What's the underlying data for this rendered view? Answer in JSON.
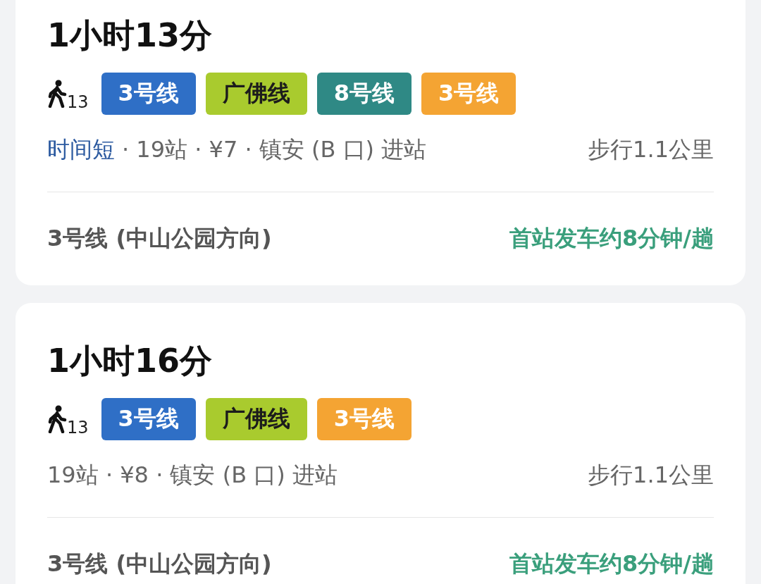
{
  "routes": [
    {
      "duration": "1小时13分",
      "walk_minutes": "13",
      "lines": [
        {
          "label": "3号线",
          "color": "#2f6fc6"
        },
        {
          "label": "广佛线",
          "color": "#a9cb2e"
        },
        {
          "label": "8号线",
          "color": "#2f8985"
        },
        {
          "label": "3号线",
          "color": "#f4a433"
        }
      ],
      "tag": "时间短",
      "summary": "· 19站 · ¥7 · 镇安 (B 口) 进站",
      "walk": "步行1.1公里",
      "first_line": "3号线 (中山公园方向)",
      "frequency": "首站发车约8分钟/趟"
    },
    {
      "duration": "1小时16分",
      "walk_minutes": "13",
      "lines": [
        {
          "label": "3号线",
          "color": "#2f6fc6"
        },
        {
          "label": "广佛线",
          "color": "#a9cb2e"
        },
        {
          "label": "3号线",
          "color": "#f4a433"
        }
      ],
      "summary": "19站 · ¥8 · 镇安 (B 口) 进站",
      "walk": "步行1.1公里",
      "first_line": "3号线 (中山公园方向)",
      "frequency": "首站发车约8分钟/趟"
    }
  ]
}
